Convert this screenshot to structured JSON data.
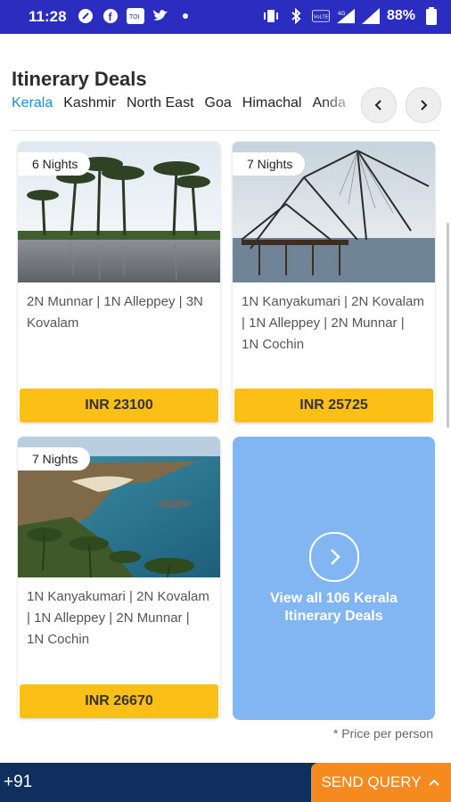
{
  "status_bar": {
    "time": "11:28",
    "battery": "88%",
    "left_icons": [
      "link-icon",
      "facebook-icon",
      "toi-icon",
      "twitter-icon",
      "dot-icon"
    ],
    "right_icons": [
      "vibrate-icon",
      "bluetooth-icon",
      "volte-icon",
      "signal-4g-icon",
      "signal-icon",
      "battery-icon"
    ],
    "toi_label": "TOI",
    "volte_label": "VoLTE",
    "network_label": "4G"
  },
  "section": {
    "title": "Itinerary Deals",
    "tabs": [
      "Kerala",
      "Kashmir",
      "North East",
      "Goa",
      "Himachal",
      "Anda"
    ],
    "active_tab": "Kerala"
  },
  "cards": [
    {
      "nights": "6 Nights",
      "desc": "2N Munnar |  1N Alleppey  |  3N Kovalam",
      "price": "INR 23100"
    },
    {
      "nights": "7 Nights",
      "desc": "1N Kanyakumari |  2N Kovalam |  1N Alleppey |  2N Munnar |  1N Cochin",
      "price": "INR 25725"
    },
    {
      "nights": "7 Nights",
      "desc": "1N Kanyakumari |  2N Kovalam |  1N Alleppey |  2N Munnar |  1N Cochin",
      "price": "INR 26670"
    }
  ],
  "view_all": {
    "text": "View all 106 Kerala Itinerary Deals"
  },
  "price_note": "* Price per person",
  "bottom_bar": {
    "phone_code": "+91",
    "send_query": "SEND QUERY"
  },
  "colors": {
    "status_bar": "#2a2dbf",
    "accent": "#1e88e5",
    "price": "#fbbf16",
    "view_all": "#82b6f2",
    "bottom_bar": "#0f2f5e",
    "send_button": "#f58a1f"
  }
}
